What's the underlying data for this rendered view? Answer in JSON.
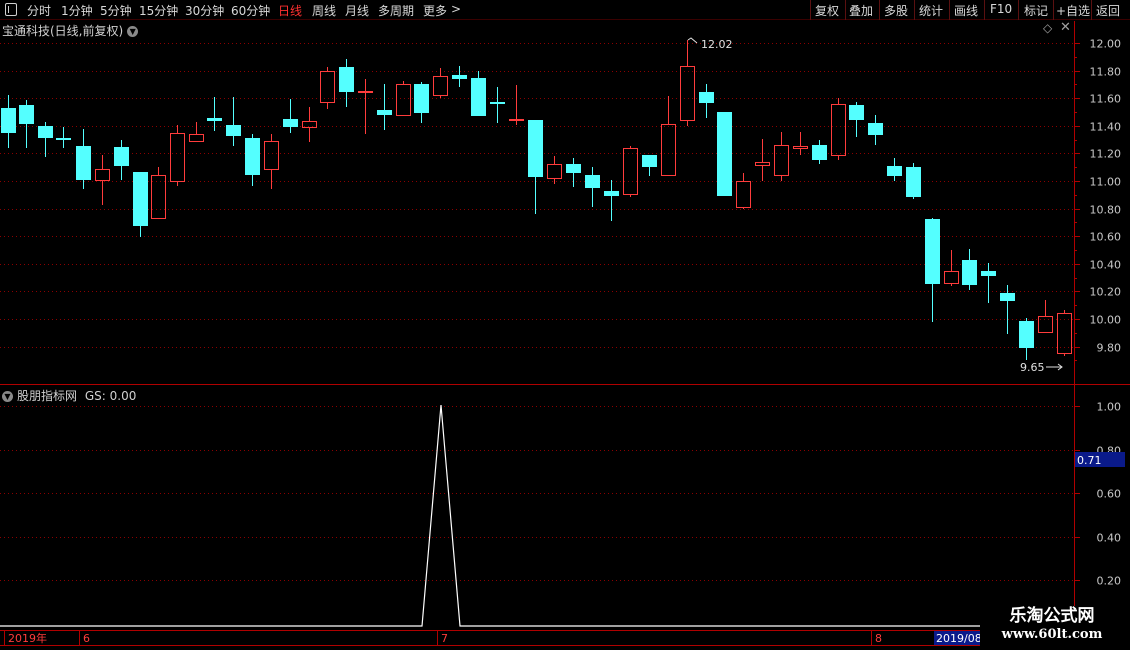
{
  "toolbar": {
    "periods": [
      "分时",
      "1分钟",
      "5分钟",
      "15分钟",
      "30分钟",
      "60分钟",
      "日线",
      "周线",
      "月线",
      "多周期",
      "更多"
    ],
    "active_period": "日线",
    "more_arrow": ">",
    "right_buttons": [
      "复权",
      "叠加",
      "多股",
      "统计",
      "画线",
      "F10",
      "+自选",
      "返回"
    ],
    "mark_label": "标记"
  },
  "main_chart": {
    "title": "宝通科技(日线,前复权)",
    "y_ticks": [
      "12.00",
      "11.80",
      "11.60",
      "11.40",
      "11.20",
      "11.00",
      "10.80",
      "10.60",
      "10.40",
      "10.20",
      "10.00",
      "9.80"
    ],
    "high_marker": "12.02",
    "low_marker": "9.65",
    "colors": {
      "up": "#ff3c3c",
      "down": "#54ffff",
      "grid": "#8b0000",
      "axis": "#b00000"
    }
  },
  "indicator": {
    "title": "股朋指标网",
    "gs_text": "GS: 0.00",
    "y_ticks": [
      "1.00",
      "0.80",
      "0.60",
      "0.40",
      "0.20"
    ],
    "current_value": "0.71"
  },
  "time_axis": {
    "labels": [
      "2019年",
      "6",
      "7",
      "8"
    ],
    "cursor_date": "2019/08"
  },
  "watermark": {
    "line1": "乐淘公式网",
    "line2": "www.60lt.com"
  }
}
